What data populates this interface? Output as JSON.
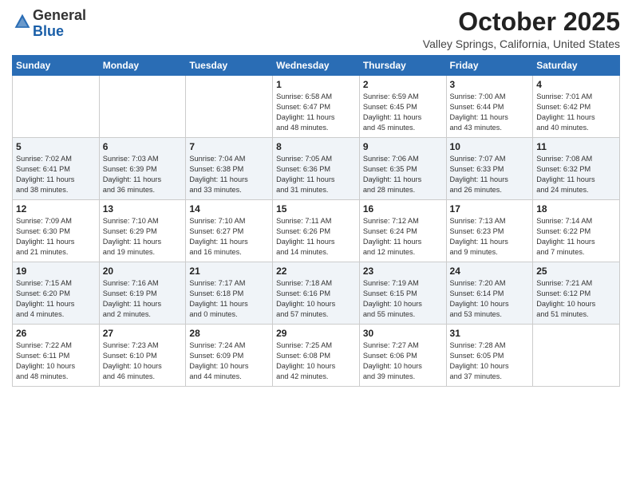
{
  "logo": {
    "general": "General",
    "blue": "Blue"
  },
  "header": {
    "month": "October 2025",
    "location": "Valley Springs, California, United States"
  },
  "weekdays": [
    "Sunday",
    "Monday",
    "Tuesday",
    "Wednesday",
    "Thursday",
    "Friday",
    "Saturday"
  ],
  "weeks": [
    [
      {
        "day": "",
        "info": ""
      },
      {
        "day": "",
        "info": ""
      },
      {
        "day": "",
        "info": ""
      },
      {
        "day": "1",
        "info": "Sunrise: 6:58 AM\nSunset: 6:47 PM\nDaylight: 11 hours\nand 48 minutes."
      },
      {
        "day": "2",
        "info": "Sunrise: 6:59 AM\nSunset: 6:45 PM\nDaylight: 11 hours\nand 45 minutes."
      },
      {
        "day": "3",
        "info": "Sunrise: 7:00 AM\nSunset: 6:44 PM\nDaylight: 11 hours\nand 43 minutes."
      },
      {
        "day": "4",
        "info": "Sunrise: 7:01 AM\nSunset: 6:42 PM\nDaylight: 11 hours\nand 40 minutes."
      }
    ],
    [
      {
        "day": "5",
        "info": "Sunrise: 7:02 AM\nSunset: 6:41 PM\nDaylight: 11 hours\nand 38 minutes."
      },
      {
        "day": "6",
        "info": "Sunrise: 7:03 AM\nSunset: 6:39 PM\nDaylight: 11 hours\nand 36 minutes."
      },
      {
        "day": "7",
        "info": "Sunrise: 7:04 AM\nSunset: 6:38 PM\nDaylight: 11 hours\nand 33 minutes."
      },
      {
        "day": "8",
        "info": "Sunrise: 7:05 AM\nSunset: 6:36 PM\nDaylight: 11 hours\nand 31 minutes."
      },
      {
        "day": "9",
        "info": "Sunrise: 7:06 AM\nSunset: 6:35 PM\nDaylight: 11 hours\nand 28 minutes."
      },
      {
        "day": "10",
        "info": "Sunrise: 7:07 AM\nSunset: 6:33 PM\nDaylight: 11 hours\nand 26 minutes."
      },
      {
        "day": "11",
        "info": "Sunrise: 7:08 AM\nSunset: 6:32 PM\nDaylight: 11 hours\nand 24 minutes."
      }
    ],
    [
      {
        "day": "12",
        "info": "Sunrise: 7:09 AM\nSunset: 6:30 PM\nDaylight: 11 hours\nand 21 minutes."
      },
      {
        "day": "13",
        "info": "Sunrise: 7:10 AM\nSunset: 6:29 PM\nDaylight: 11 hours\nand 19 minutes."
      },
      {
        "day": "14",
        "info": "Sunrise: 7:10 AM\nSunset: 6:27 PM\nDaylight: 11 hours\nand 16 minutes."
      },
      {
        "day": "15",
        "info": "Sunrise: 7:11 AM\nSunset: 6:26 PM\nDaylight: 11 hours\nand 14 minutes."
      },
      {
        "day": "16",
        "info": "Sunrise: 7:12 AM\nSunset: 6:24 PM\nDaylight: 11 hours\nand 12 minutes."
      },
      {
        "day": "17",
        "info": "Sunrise: 7:13 AM\nSunset: 6:23 PM\nDaylight: 11 hours\nand 9 minutes."
      },
      {
        "day": "18",
        "info": "Sunrise: 7:14 AM\nSunset: 6:22 PM\nDaylight: 11 hours\nand 7 minutes."
      }
    ],
    [
      {
        "day": "19",
        "info": "Sunrise: 7:15 AM\nSunset: 6:20 PM\nDaylight: 11 hours\nand 4 minutes."
      },
      {
        "day": "20",
        "info": "Sunrise: 7:16 AM\nSunset: 6:19 PM\nDaylight: 11 hours\nand 2 minutes."
      },
      {
        "day": "21",
        "info": "Sunrise: 7:17 AM\nSunset: 6:18 PM\nDaylight: 11 hours\nand 0 minutes."
      },
      {
        "day": "22",
        "info": "Sunrise: 7:18 AM\nSunset: 6:16 PM\nDaylight: 10 hours\nand 57 minutes."
      },
      {
        "day": "23",
        "info": "Sunrise: 7:19 AM\nSunset: 6:15 PM\nDaylight: 10 hours\nand 55 minutes."
      },
      {
        "day": "24",
        "info": "Sunrise: 7:20 AM\nSunset: 6:14 PM\nDaylight: 10 hours\nand 53 minutes."
      },
      {
        "day": "25",
        "info": "Sunrise: 7:21 AM\nSunset: 6:12 PM\nDaylight: 10 hours\nand 51 minutes."
      }
    ],
    [
      {
        "day": "26",
        "info": "Sunrise: 7:22 AM\nSunset: 6:11 PM\nDaylight: 10 hours\nand 48 minutes."
      },
      {
        "day": "27",
        "info": "Sunrise: 7:23 AM\nSunset: 6:10 PM\nDaylight: 10 hours\nand 46 minutes."
      },
      {
        "day": "28",
        "info": "Sunrise: 7:24 AM\nSunset: 6:09 PM\nDaylight: 10 hours\nand 44 minutes."
      },
      {
        "day": "29",
        "info": "Sunrise: 7:25 AM\nSunset: 6:08 PM\nDaylight: 10 hours\nand 42 minutes."
      },
      {
        "day": "30",
        "info": "Sunrise: 7:27 AM\nSunset: 6:06 PM\nDaylight: 10 hours\nand 39 minutes."
      },
      {
        "day": "31",
        "info": "Sunrise: 7:28 AM\nSunset: 6:05 PM\nDaylight: 10 hours\nand 37 minutes."
      },
      {
        "day": "",
        "info": ""
      }
    ]
  ]
}
